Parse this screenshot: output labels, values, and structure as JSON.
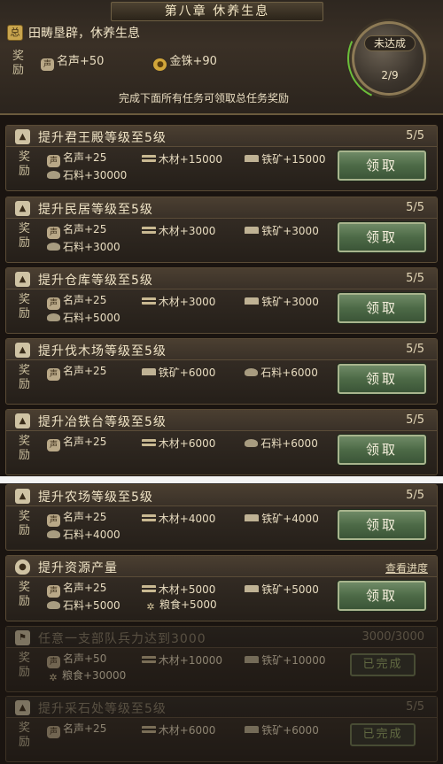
{
  "header": {
    "chapter_title": "第八章  休养生息",
    "chapter_name": "田畴垦辟，休养生息",
    "reward_label": "奖励",
    "rewards": [
      {
        "icon": "fame-icon",
        "text": "名声+50"
      },
      {
        "icon": "gold-icon",
        "text": "金铢+90"
      }
    ],
    "status": "未达成",
    "progress": "2/9",
    "progress_fraction": 0.22,
    "hint": "完成下面所有任务可领取总任务奖励"
  },
  "tasks": [
    {
      "title": "提升君王殿等级至5级",
      "count": "5/5",
      "reward_label": "奖励",
      "rewards": [
        "名声+25",
        "木材+15000",
        "铁矿+15000",
        "石料+30000"
      ],
      "button": "领取"
    },
    {
      "title": "提升民居等级至5级",
      "count": "5/5",
      "reward_label": "奖励",
      "rewards": [
        "名声+25",
        "木材+3000",
        "铁矿+3000",
        "石料+3000"
      ],
      "button": "领取"
    },
    {
      "title": "提升仓库等级至5级",
      "count": "5/5",
      "reward_label": "奖励",
      "rewards": [
        "名声+25",
        "木材+3000",
        "铁矿+3000",
        "石料+5000"
      ],
      "button": "领取"
    },
    {
      "title": "提升伐木场等级至5级",
      "count": "5/5",
      "reward_label": "奖励",
      "rewards": [
        "名声+25",
        "铁矿+6000",
        "石料+6000"
      ],
      "button": "领取"
    },
    {
      "title": "提升冶铁台等级至5级",
      "count": "5/5",
      "reward_label": "奖励",
      "rewards": [
        "名声+25",
        "木材+6000",
        "石料+6000"
      ],
      "button": "领取"
    },
    {
      "title": "提升农场等级至5级",
      "count": "5/5",
      "reward_label": "奖励",
      "rewards": [
        "名声+25",
        "木材+4000",
        "铁矿+4000",
        "石料+4000"
      ],
      "button": "领取"
    },
    {
      "title": "提升资源产量",
      "link": "查看进度",
      "reward_label": "奖励",
      "rewards": [
        "名声+25",
        "木材+5000",
        "铁矿+5000",
        "石料+5000",
        "粮食+5000"
      ],
      "button": "领取"
    },
    {
      "title": "任意一支部队兵力达到3000",
      "count": "3000/3000",
      "reward_label": "奖励",
      "rewards": [
        "名声+50",
        "木材+10000",
        "铁矿+10000",
        "粮食+30000"
      ],
      "button": "已完成"
    },
    {
      "title": "提升采石处等级至5级",
      "count": "5/5",
      "reward_label": "奖励",
      "rewards": [
        "名声+25",
        "木材+6000",
        "铁矿+6000"
      ],
      "button": "已完成"
    }
  ]
}
